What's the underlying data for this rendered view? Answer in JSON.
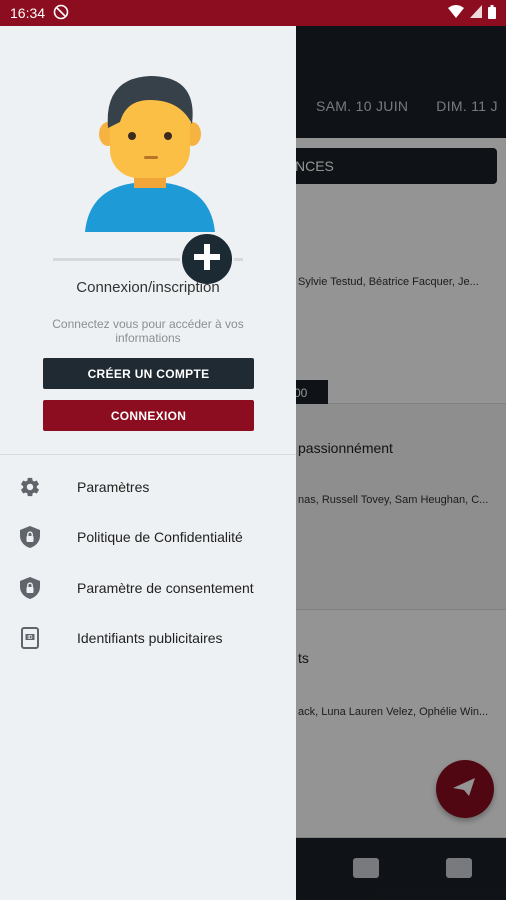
{
  "status_bar": {
    "time": "16:34"
  },
  "background": {
    "tabs": [
      "SAM. 10 JUIN",
      "DIM. 11 J"
    ],
    "seances_label": "NCES",
    "cards": [
      {
        "cast": "Sylvie Testud, Béatrice Facquer, Je...",
        "time": "00"
      },
      {
        "title": "passionnément",
        "cast": "nas, Russell Tovey, Sam Heughan, C..."
      },
      {
        "title": "ts",
        "cast": "ack, Luna Lauren Velez, Ophélie Win..."
      }
    ],
    "colors": {
      "header": "#1b2027",
      "accent": "#8c0d1f"
    }
  },
  "drawer": {
    "title": "Connexion/inscription",
    "subtitle": "Connectez vous pour accéder à vos informations",
    "create_account_label": "CRÉER UN COMPTE",
    "login_label": "CONNEXION",
    "menu": [
      {
        "icon": "gear-icon",
        "label": "Paramètres"
      },
      {
        "icon": "shield-lock-icon",
        "label": "Politique de Confidentialité"
      },
      {
        "icon": "shield-lock-icon",
        "label": "Paramètre de consentement"
      },
      {
        "icon": "id-card-icon",
        "label": "Identifiants publicitaires"
      }
    ]
  }
}
